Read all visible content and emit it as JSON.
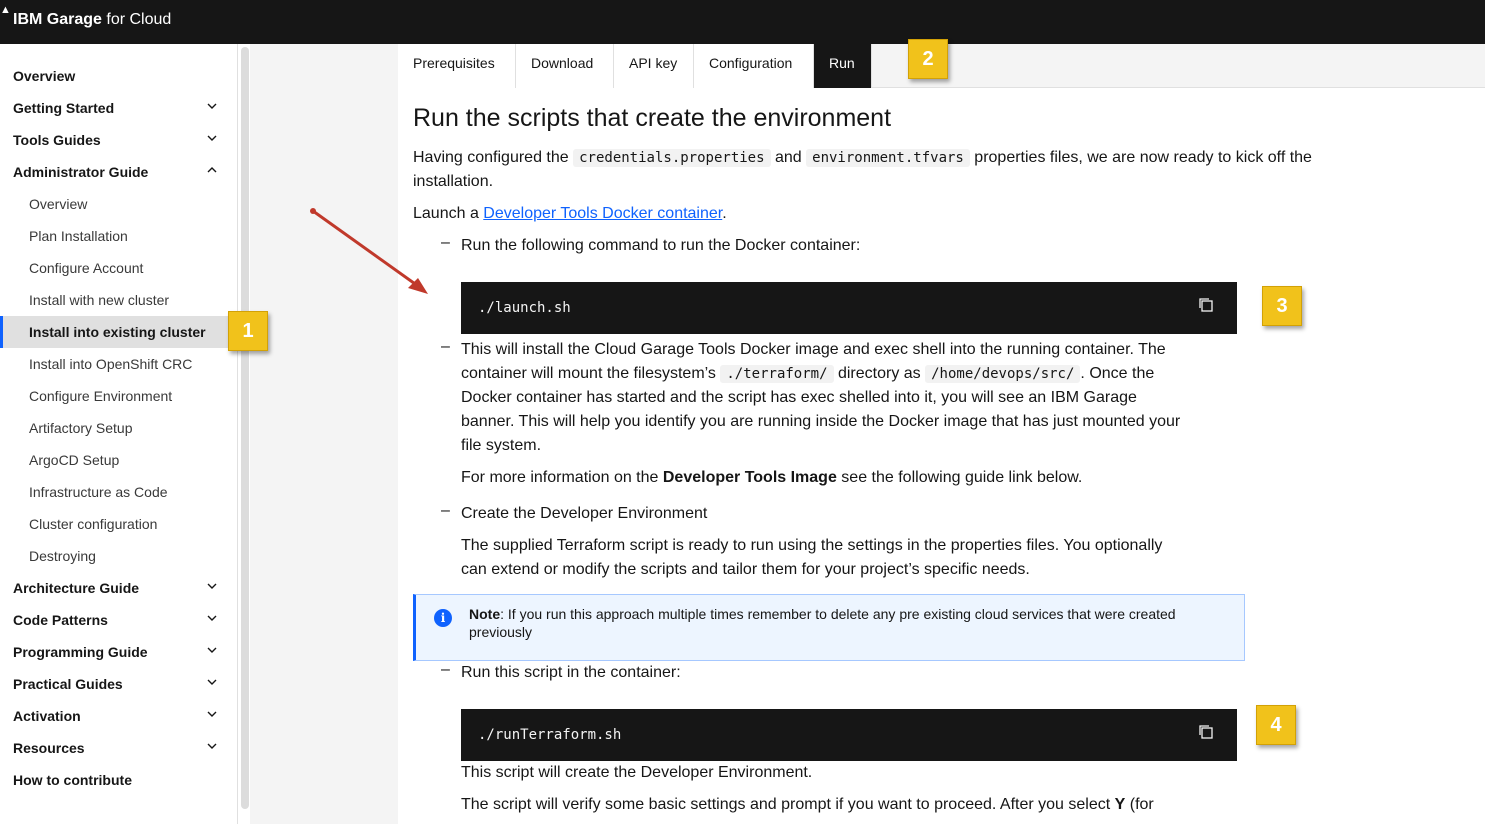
{
  "header": {
    "brand_bold": "IBM Garage",
    "brand_rest": " for Cloud"
  },
  "sidebar": {
    "items": [
      {
        "label": "Overview",
        "level": "top"
      },
      {
        "label": "Getting Started",
        "level": "top",
        "chevron": "down"
      },
      {
        "label": "Tools Guides",
        "level": "top",
        "chevron": "down"
      },
      {
        "label": "Administrator Guide",
        "level": "top",
        "chevron": "up"
      },
      {
        "label": "Overview",
        "level": "sub"
      },
      {
        "label": "Plan Installation",
        "level": "sub"
      },
      {
        "label": "Configure Account",
        "level": "sub"
      },
      {
        "label": "Install with new cluster",
        "level": "sub"
      },
      {
        "label": "Install into existing cluster",
        "level": "sub",
        "active": true
      },
      {
        "label": "Install into OpenShift CRC",
        "level": "sub"
      },
      {
        "label": "Configure Environment",
        "level": "sub"
      },
      {
        "label": "Artifactory Setup",
        "level": "sub"
      },
      {
        "label": "ArgoCD Setup",
        "level": "sub"
      },
      {
        "label": "Infrastructure as Code",
        "level": "sub"
      },
      {
        "label": "Cluster configuration",
        "level": "sub"
      },
      {
        "label": "Destroying",
        "level": "sub"
      },
      {
        "label": "Architecture Guide",
        "level": "top",
        "chevron": "down"
      },
      {
        "label": "Code Patterns",
        "level": "top",
        "chevron": "down"
      },
      {
        "label": "Programming Guide",
        "level": "top",
        "chevron": "down"
      },
      {
        "label": "Practical Guides",
        "level": "top",
        "chevron": "down"
      },
      {
        "label": "Activation",
        "level": "top",
        "chevron": "down"
      },
      {
        "label": "Resources",
        "level": "top",
        "chevron": "down"
      },
      {
        "label": "How to contribute",
        "level": "top"
      }
    ]
  },
  "tabs": [
    {
      "label": "Prerequisites"
    },
    {
      "label": "Download"
    },
    {
      "label": "API key"
    },
    {
      "label": "Configuration"
    },
    {
      "label": "Run",
      "active": true
    }
  ],
  "badges": [
    "1",
    "2",
    "3",
    "4"
  ],
  "content": {
    "title": "Run the scripts that create the environment",
    "intro_a": "Having configured the ",
    "intro_code1": "credentials.properties",
    "intro_b": " and ",
    "intro_code2": "environment.tfvars",
    "intro_c": " properties files, we are now ready to kick off the",
    "intro_d": "installation.",
    "launch_a": "Launch a ",
    "launch_link": "Developer Tools Docker container",
    "launch_b": ".",
    "step1": "Run the following command to run the Docker container:",
    "code1": "./launch.sh",
    "step2_l1": "This will install the Cloud Garage Tools Docker image and exec shell into the running container. The",
    "step2_l2a": "container will mount the filesystem’s ",
    "step2_code1": "./terraform/",
    "step2_l2b": " directory as ",
    "step2_code2": "/home/devops/src/",
    "step2_l2c": ". Once the",
    "step2_l3": "Docker container has started and the script has exec shelled into it, you will see an IBM Garage",
    "step2_l4": "banner. This will help you identify you are running inside the Docker image that has just mounted your",
    "step2_l5": "file system.",
    "moreinfo_a": "For more information on the ",
    "moreinfo_b": "Developer Tools Image",
    "moreinfo_c": " see the following guide link below.",
    "step3": "Create the Developer Environment",
    "step3_l1": "The supplied Terraform script is ready to run using the settings in the properties files. You optionally",
    "step3_l2": "can extend or modify the scripts and tailor them for your project’s specific needs.",
    "note_label": "Note",
    "note_text": ": If you run this approach multiple times remember to delete any pre existing cloud services that were created previously",
    "step4": "Run this script in the container:",
    "code2": "./runTerraform.sh",
    "after1": "This script will create the Developer Environment.",
    "after2a": "The script will verify some basic settings and prompt if you want to proceed. After you select ",
    "after2b": "Y",
    "after2c": " (for"
  },
  "colors": {
    "accent": "#0f62fe",
    "badge": "#f1c21b",
    "arrow": "#c0392b"
  }
}
